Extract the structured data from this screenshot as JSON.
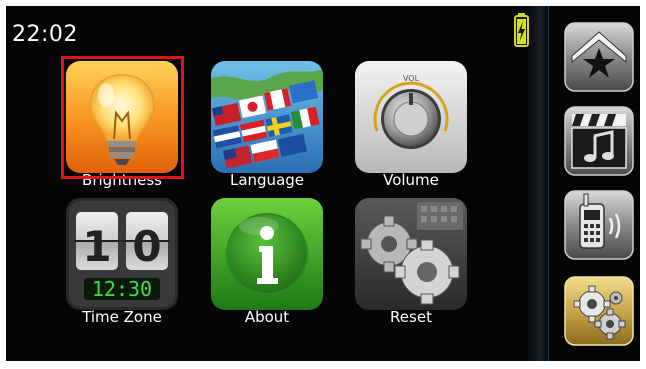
{
  "status": {
    "time": "22:02"
  },
  "menu": {
    "items": [
      {
        "label": "Brightness"
      },
      {
        "label": "Language"
      },
      {
        "label": "Volume"
      },
      {
        "label": "Time Zone"
      },
      {
        "label": "About"
      },
      {
        "label": "Reset"
      }
    ],
    "selected": "Brightness"
  },
  "timezone_icon": {
    "digits": "10",
    "clock": "12:30"
  },
  "volume_icon": {
    "knob_text": "VOL"
  },
  "colors": {
    "selection": "#e0141b",
    "background": "#050505",
    "active_side": "#c9a64a"
  },
  "sidebar": {
    "buttons": [
      {
        "icon": "star-icon",
        "active": false
      },
      {
        "icon": "media-clapper-music-icon",
        "active": false
      },
      {
        "icon": "phone-icon",
        "active": false
      },
      {
        "icon": "settings-gears-icon",
        "active": true
      }
    ]
  }
}
